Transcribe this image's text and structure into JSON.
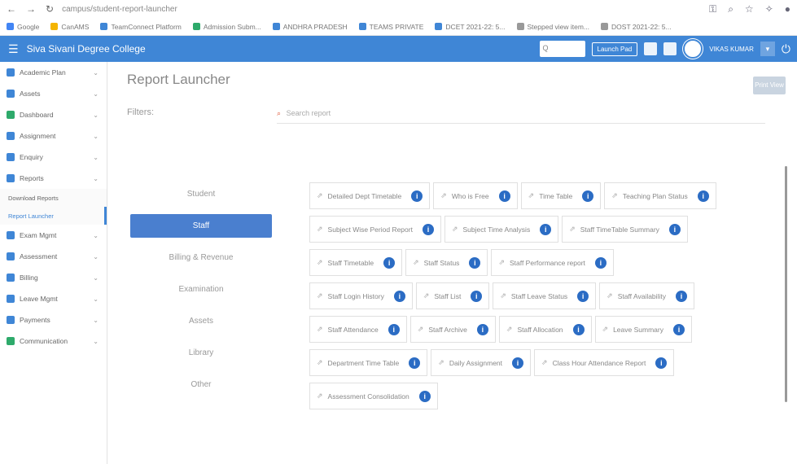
{
  "browser": {
    "url": "campus/student-report-launcher",
    "bookmarks": [
      "Google",
      "CanAMS",
      "TeamConnect Platform",
      "Admission Subm...",
      "ANDHRA PRADESH",
      "TEAMS PRIVATE",
      "DCET 2021-22: 5...",
      "Stepped view item...",
      "DOST 2021-22: 5..."
    ]
  },
  "topbar": {
    "college_name": "Siva Sivani Degree College",
    "search_placeholder": "Q",
    "launch_label": "Launch Pad",
    "user_name": "VIKAS KUMAR"
  },
  "sidebar": {
    "items": [
      {
        "label": "Academic Plan",
        "color": "#3f86d6"
      },
      {
        "label": "Assets",
        "color": "#3f86d6"
      },
      {
        "label": "Dashboard",
        "color": "#2eaa6b"
      },
      {
        "label": "Assignment",
        "color": "#3f86d6"
      },
      {
        "label": "Enquiry",
        "color": "#3f86d6"
      },
      {
        "label": "Reports",
        "color": "#3f86d6"
      }
    ],
    "sub_items": [
      "Download Reports",
      "Report Launcher"
    ],
    "items_after": [
      {
        "label": "Exam Mgmt",
        "color": "#3f86d6"
      },
      {
        "label": "Assessment",
        "color": "#3f86d6"
      },
      {
        "label": "Billing",
        "color": "#3f86d6"
      },
      {
        "label": "Leave Mgmt",
        "color": "#3f86d6"
      },
      {
        "label": "Payments",
        "color": "#3f86d6"
      },
      {
        "label": "Communication",
        "color": "#2eaa6b"
      }
    ]
  },
  "main": {
    "title": "Report Launcher",
    "print_label": "Print View",
    "filters_label": "Filters:",
    "search_placeholder": "Search report",
    "categories": [
      "Student",
      "Staff",
      "Billing & Revenue",
      "Examination",
      "Assets",
      "Library",
      "Other"
    ],
    "active_category": "Staff",
    "report_rows": [
      [
        "Detailed Dept Timetable",
        "Who is Free",
        "Time Table",
        "Teaching Plan Status"
      ],
      [
        "Subject Wise Period Report",
        "Subject Time Analysis",
        "Staff TimeTable Summary"
      ],
      [
        "Staff Timetable",
        "Staff Status",
        "Staff Performance report"
      ],
      [
        "Staff Login History",
        "Staff List",
        "Staff Leave Status",
        "Staff Availability"
      ],
      [
        "Staff Attendance",
        "Staff Archive",
        "Staff Allocation",
        "Leave Summary"
      ],
      [
        "Department Time Table",
        "Daily Assignment",
        "Class Hour Attendance Report"
      ],
      [
        "Assessment Consolidation"
      ]
    ]
  }
}
